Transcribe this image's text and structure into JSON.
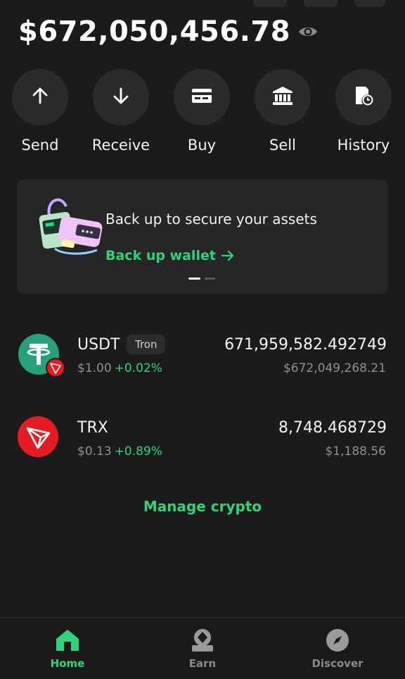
{
  "wallet": {
    "balance": "$672,050,456.78",
    "eye_icon": "eye-icon"
  },
  "actions": [
    {
      "label": "Send",
      "icon": "arrow-up-icon"
    },
    {
      "label": "Receive",
      "icon": "arrow-down-icon"
    },
    {
      "label": "Buy",
      "icon": "card-icon"
    },
    {
      "label": "Sell",
      "icon": "bank-icon"
    },
    {
      "label": "History",
      "icon": "history-icon"
    }
  ],
  "banner": {
    "title": "Back up to secure your assets",
    "link": "Back up wallet",
    "page_index": 1,
    "page_count": 2
  },
  "assets": [
    {
      "symbol": "USDT",
      "network": "Tron",
      "price": "$1.00",
      "change": "+0.02%",
      "amount": "671,959,582.492749",
      "value": "$672,049,268.21"
    },
    {
      "symbol": "TRX",
      "network": "",
      "price": "$0.13",
      "change": "+0.89%",
      "amount": "8,748.468729",
      "value": "$1,188.56"
    }
  ],
  "manage_label": "Manage crypto",
  "nav": [
    {
      "label": "Home",
      "icon": "home-icon",
      "active": true
    },
    {
      "label": "Earn",
      "icon": "earn-icon",
      "active": false
    },
    {
      "label": "Discover",
      "icon": "compass-icon",
      "active": false
    }
  ],
  "colors": {
    "background": "#1b1b1b",
    "accent": "#2ed47a",
    "usdt": "#26a17b",
    "trx": "#e51c23"
  }
}
